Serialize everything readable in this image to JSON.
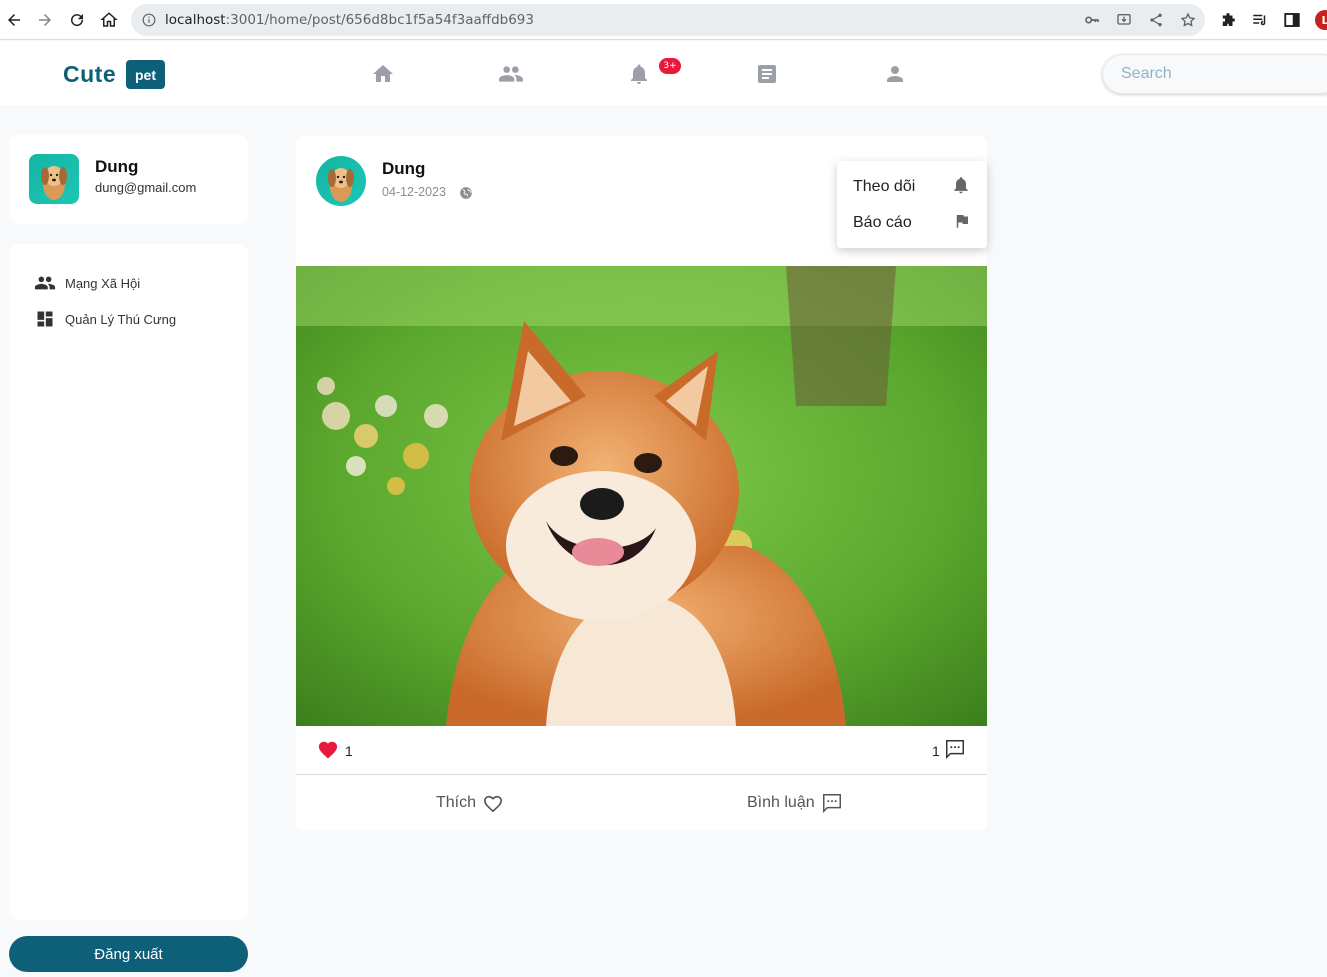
{
  "browser": {
    "url_host": "localhost",
    "url_rest": ":3001/home/post/656d8bc1f5a54f3aaffdb693",
    "profile_initial": "L"
  },
  "header": {
    "logo_text": "Cute",
    "logo_badge": "pet",
    "notification_badge": "3+",
    "search_placeholder": "Search",
    "nav_icons": [
      "home-icon",
      "friends-icon",
      "bell-icon",
      "news-icon",
      "person-icon"
    ]
  },
  "sidebar": {
    "profile": {
      "name": "Dung",
      "email": "dung@gmail.com"
    },
    "items": [
      {
        "label": "Mạng Xã Hội",
        "icon": "people-icon"
      },
      {
        "label": "Quản Lý Thú Cưng",
        "icon": "dashboard-icon"
      }
    ],
    "logout_label": "Đăng xuất"
  },
  "post": {
    "author": "Dung",
    "date": "04-12-2023",
    "like_count": "1",
    "comment_count": "1",
    "like_label": "Thích",
    "comment_label": "Bình luận"
  },
  "dropdown": {
    "items": [
      {
        "label": "Theo dõi",
        "icon": "bell-icon"
      },
      {
        "label": "Báo cáo",
        "icon": "flag-icon"
      }
    ]
  },
  "colors": {
    "brand": "#0e6079",
    "badge": "#e8193c",
    "like_heart": "#e8193c",
    "nav_icon": "#9aa0a6"
  }
}
